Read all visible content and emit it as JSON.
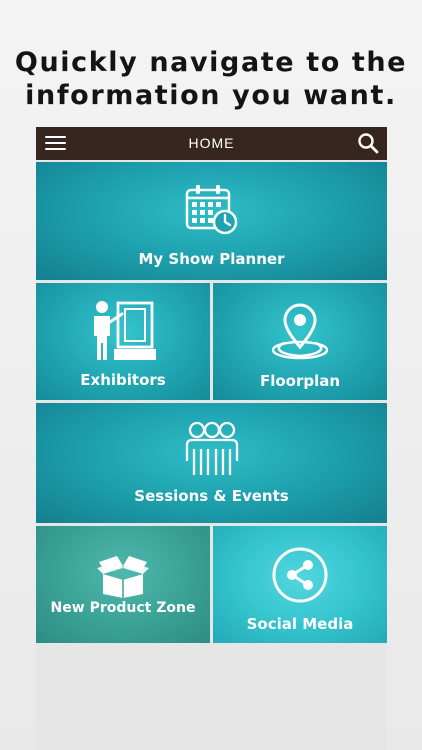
{
  "caption": {
    "line1": "Quickly navigate to the",
    "line2": "information you want."
  },
  "header": {
    "title": "HOME",
    "menu_icon": "hamburger-menu-icon",
    "search_icon": "search-icon"
  },
  "tiles": [
    {
      "label": "My Show Planner",
      "icon": "calendar-clock-icon"
    },
    {
      "label": "Exhibitors",
      "icon": "exhibitor-presenter-icon"
    },
    {
      "label": "Floorplan",
      "icon": "map-pin-icon"
    },
    {
      "label": "Sessions & Events",
      "icon": "people-group-icon"
    },
    {
      "label": "New Product Zone",
      "icon": "open-box-icon"
    },
    {
      "label": "Social Media",
      "icon": "share-icon"
    }
  ],
  "colors": {
    "top_bar": "#37261f",
    "tile_teal": "#1fa3b0",
    "tile_green": "#3aa195",
    "tile_light": "#33c3cd"
  }
}
